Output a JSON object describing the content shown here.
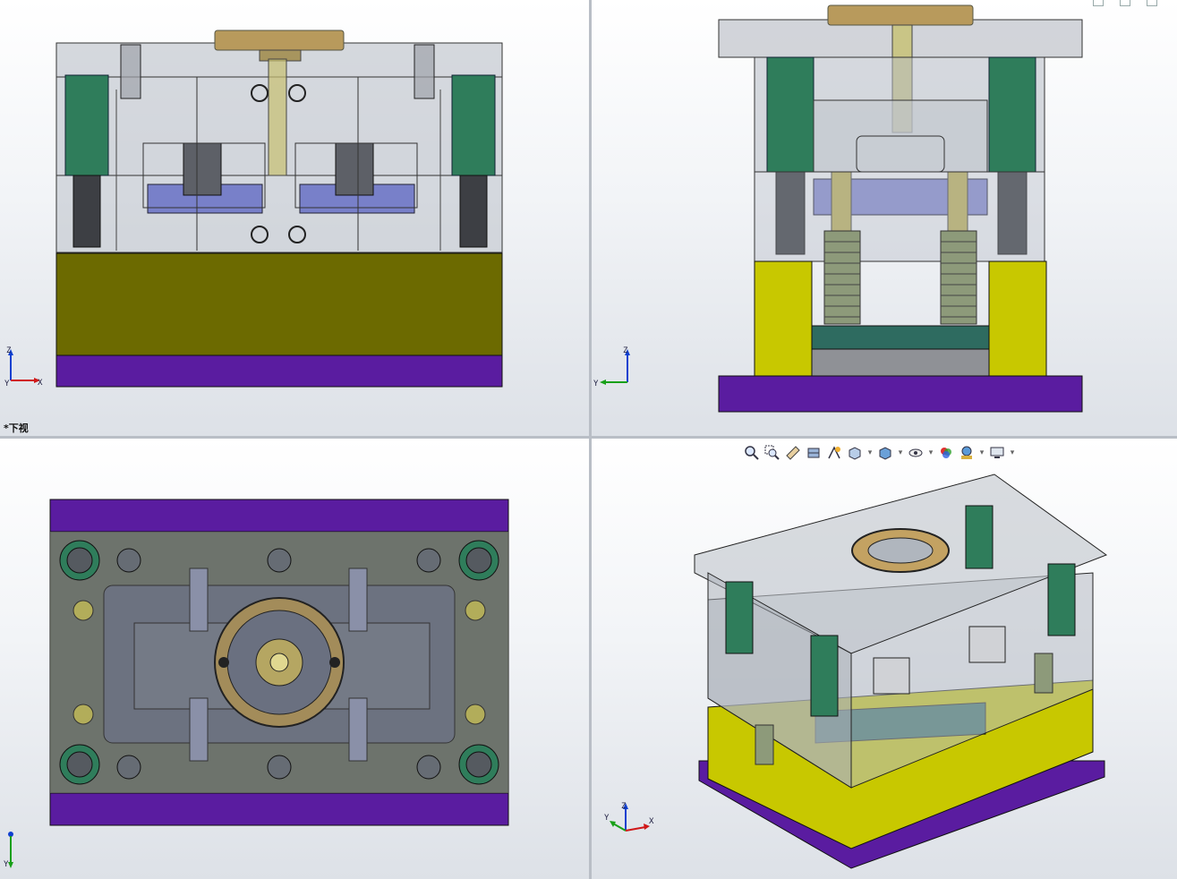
{
  "app": {
    "name": "3D CAD four-viewport layout"
  },
  "viewports": {
    "front": {
      "axis_labels": {
        "up": "Z",
        "right": "X",
        "origin": "Y"
      }
    },
    "right": {
      "axis_labels": {
        "up": "Z",
        "left": "Y"
      }
    },
    "bottom": {
      "label": "*下视",
      "axis_labels": {
        "down": "Y"
      }
    },
    "isometric": {
      "axis_labels": {
        "up": "Z",
        "left": "Y",
        "right": "X"
      }
    }
  },
  "toolbar": {
    "items": [
      {
        "icon": "zoom-to-fit-icon",
        "dropdown": false
      },
      {
        "icon": "zoom-to-area-icon",
        "dropdown": false
      },
      {
        "icon": "previous-view-icon",
        "dropdown": false
      },
      {
        "icon": "section-view-icon",
        "dropdown": false
      },
      {
        "icon": "dynamic-annotation-icon",
        "dropdown": false
      },
      {
        "icon": "view-orientation-icon",
        "dropdown": true
      },
      {
        "icon": "display-style-icon",
        "dropdown": true
      },
      {
        "icon": "hide-show-icon",
        "dropdown": true
      },
      {
        "icon": "edit-appearance-icon",
        "dropdown": false
      },
      {
        "icon": "apply-scene-icon",
        "dropdown": true
      },
      {
        "icon": "view-settings-icon",
        "dropdown": true
      }
    ]
  },
  "colors": {
    "clamp_plate_purple": "#5b1b9e",
    "spacer_block_yellow": "#6b6b00",
    "spacer_block_bright": "#c8c800",
    "plate_glass": "#b8bcc4",
    "guide_bushing_green": "#2e7d5a",
    "locating_ring_bronze": "#b8985a",
    "ejector_plate_teal": "#2e6b60",
    "cavity_blue": "#5560c0"
  }
}
